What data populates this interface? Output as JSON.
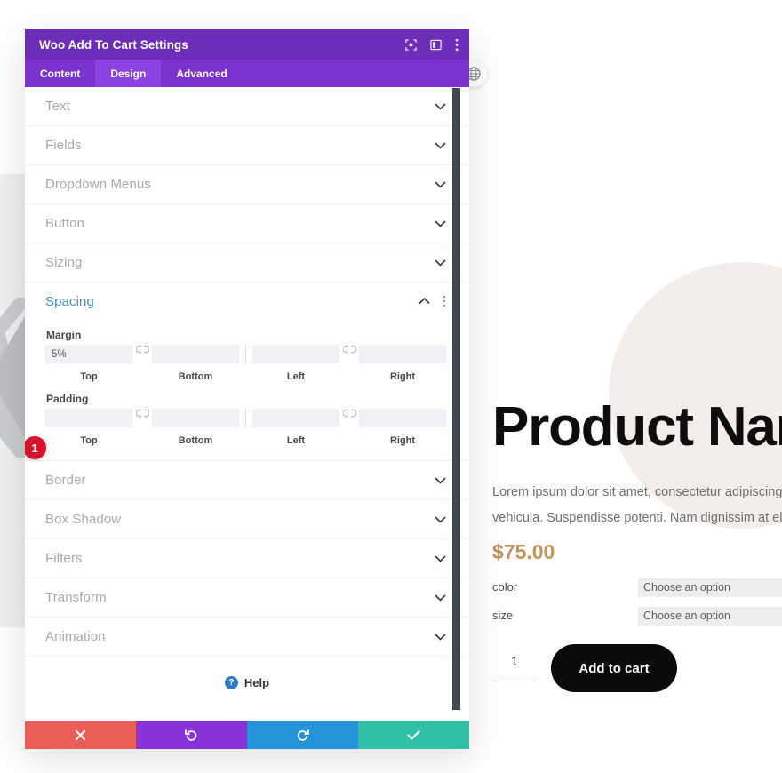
{
  "modal": {
    "title": "Woo Add To Cart Settings",
    "header_icons": [
      {
        "name": "focus-target-icon",
        "label": "Focus"
      },
      {
        "name": "layout-panel-icon",
        "label": "Layout"
      },
      {
        "name": "kebab-menu-icon",
        "label": "More options"
      }
    ],
    "tabs": [
      {
        "label": "Content",
        "active": false
      },
      {
        "label": "Design",
        "active": true
      },
      {
        "label": "Advanced",
        "active": false
      }
    ],
    "sections_top": [
      {
        "label": "Text"
      },
      {
        "label": "Fields"
      },
      {
        "label": "Dropdown Menus"
      },
      {
        "label": "Button"
      },
      {
        "label": "Sizing"
      }
    ],
    "spacing": {
      "title": "Spacing",
      "margin_label": "Margin",
      "padding_label": "Padding",
      "margin": {
        "top": "5%",
        "bottom": "",
        "left": "",
        "right": "",
        "captions": {
          "top": "Top",
          "bottom": "Bottom",
          "left": "Left",
          "right": "Right"
        }
      },
      "padding": {
        "top": "",
        "bottom": "",
        "left": "",
        "right": "",
        "captions": {
          "top": "Top",
          "bottom": "Bottom",
          "left": "Left",
          "right": "Right"
        }
      },
      "badge": "1"
    },
    "sections_bottom": [
      {
        "label": "Border"
      },
      {
        "label": "Box Shadow"
      },
      {
        "label": "Filters"
      },
      {
        "label": "Transform"
      },
      {
        "label": "Animation"
      }
    ],
    "help": {
      "label": "Help",
      "icon": "question-mark-icon"
    },
    "footer": [
      {
        "name": "cancel-button",
        "icon": "close-x-icon",
        "color": "#eb5d57"
      },
      {
        "name": "undo-button",
        "icon": "undo-arrow-icon",
        "color": "#8832d9"
      },
      {
        "name": "redo-button",
        "icon": "redo-arrow-icon",
        "color": "#2593da"
      },
      {
        "name": "save-button",
        "icon": "checkmark-icon",
        "color": "#2ec1a4"
      }
    ]
  },
  "preview": {
    "product_title": "Product Name",
    "description": "Lorem ipsum dolor sit amet, consectetur adipiscing elit. Nulla vehicula. Suspendisse potenti. Nam dignissim at elit non",
    "description_line1": "Lorem ipsum dolor sit amet, consectetur adipiscing elit. N",
    "description_line2": "vehicula. Suspendisse potenti. Nam dignissim at elit non",
    "price": "$75.00",
    "options": [
      {
        "label": "color",
        "value": "Choose an option"
      },
      {
        "label": "size",
        "value": "Choose an option"
      }
    ],
    "quantity": "1",
    "add_to_cart": "Add to cart"
  },
  "colors": {
    "header_purple": "#6c2eb9",
    "tabs_purple": "#7b32cf",
    "tab_active": "#8d43e3",
    "accent_blue": "#4a90c4",
    "badge_red": "#d6132c",
    "price_gold": "#c4935a",
    "blob_cream": "#f4eeea"
  }
}
